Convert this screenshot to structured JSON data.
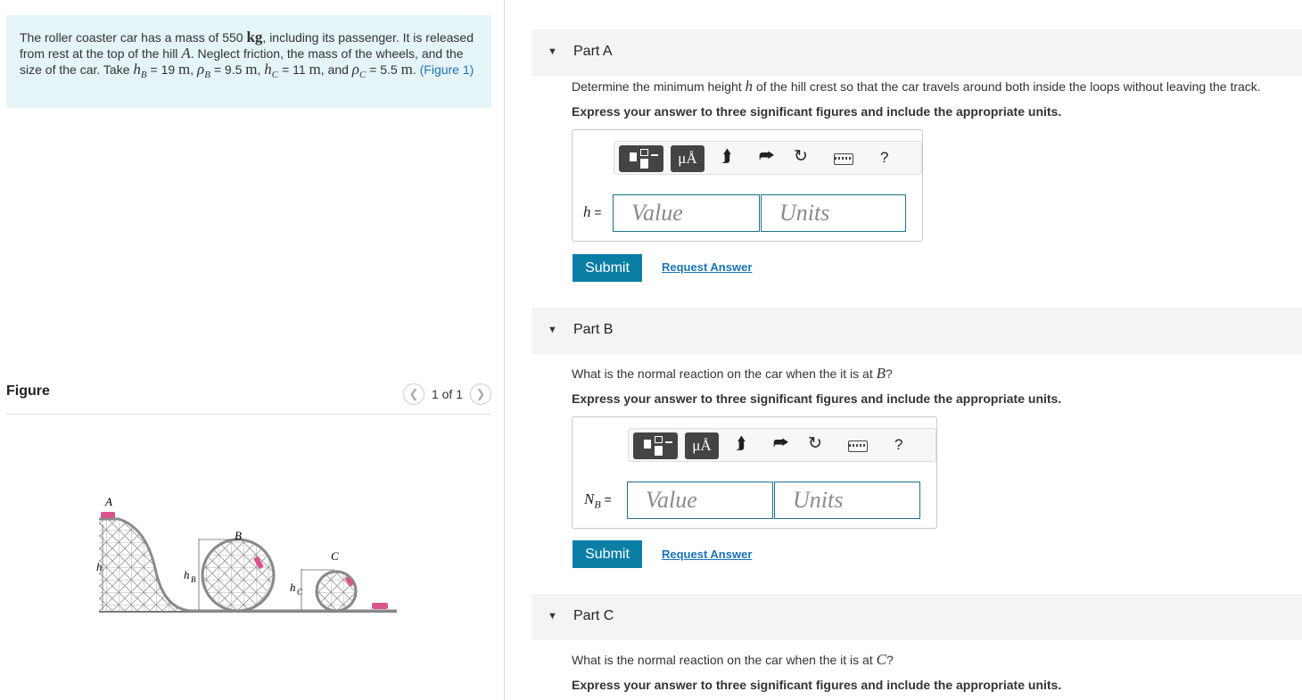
{
  "problem": {
    "text_1": "The roller coaster car has a mass of 550",
    "mass_unit": "kg",
    "text_2": ", including its passenger. It is released from rest at the top of the hill",
    "hill": "A",
    "text_3": ". Neglect friction, the mass of the wheels, and the size of the car. Take",
    "hB_sym": "h",
    "hB_sub": "B",
    "hB_val": " = 19",
    "pB_sym": "ρ",
    "pB_sub": "B",
    "pB_val": " = 9.5",
    "hC_sym": "h",
    "hC_sub": "C",
    "hC_val": " = 11",
    "and": "and",
    "pC_sym": "ρ",
    "pC_sub": "C",
    "pC_val": " = 5.5",
    "unit_m": "m",
    "sep": ",",
    "period": ".",
    "figure_link": "(Figure 1)"
  },
  "figure_panel": {
    "title": "Figure",
    "pager": "1 of 1",
    "prev_icon": "chevron-left-icon",
    "next_icon": "chevron-right-icon",
    "labels": {
      "A": "A",
      "B": "B",
      "C": "C",
      "h": "h",
      "hB": "h",
      "hB_sub": "B",
      "hC": "h",
      "hC_sub": "C"
    }
  },
  "toolbar": {
    "mu_label": "μÅ",
    "undo_icon": "undo-icon",
    "redo_icon": "redo-icon",
    "reset_icon": "reset-icon",
    "keyboard_icon": "keyboard-icon",
    "help_label": "?"
  },
  "parts": {
    "A": {
      "label": "Part A",
      "question_1": "Determine the minimum height",
      "question_var": "h",
      "question_2": "of the hill crest so that the car travels around both inside the loops without leaving the track.",
      "instruction": "Express your answer to three significant figures and include the appropriate units.",
      "var_label": "h",
      "eq": " =",
      "value_placeholder": "Value",
      "units_placeholder": "Units",
      "submit": "Submit",
      "request": "Request Answer"
    },
    "B": {
      "label": "Part B",
      "question_1": "What is the normal reaction on the car when the it is at",
      "question_var": "B",
      "question_2": "?",
      "instruction": "Express your answer to three significant figures and include the appropriate units.",
      "var_label": "N",
      "var_sub": "B",
      "eq": " =",
      "value_placeholder": "Value",
      "units_placeholder": "Units",
      "submit": "Submit",
      "request": "Request Answer"
    },
    "C": {
      "label": "Part C",
      "question_1": "What is the normal reaction on the car when the it is at",
      "question_var": "C",
      "question_2": "?",
      "instruction": "Express your answer to three significant figures and include the appropriate units."
    }
  },
  "colors": {
    "accent": "#0b7ea6",
    "link": "#1a74b8",
    "problem_bg": "#e5f4f7",
    "part_bg": "#f4f4f4",
    "field_border": "#1e6f8c"
  }
}
